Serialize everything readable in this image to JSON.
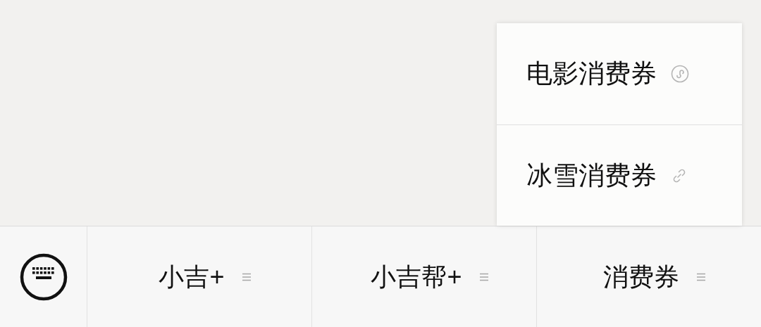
{
  "menu": [
    {
      "label": "小吉+"
    },
    {
      "label": "小吉帮+"
    },
    {
      "label": "消费券",
      "submenu": [
        {
          "label": "电影消费券",
          "kind": "miniprogram"
        },
        {
          "label": "冰雪消费券",
          "kind": "link"
        }
      ]
    }
  ]
}
